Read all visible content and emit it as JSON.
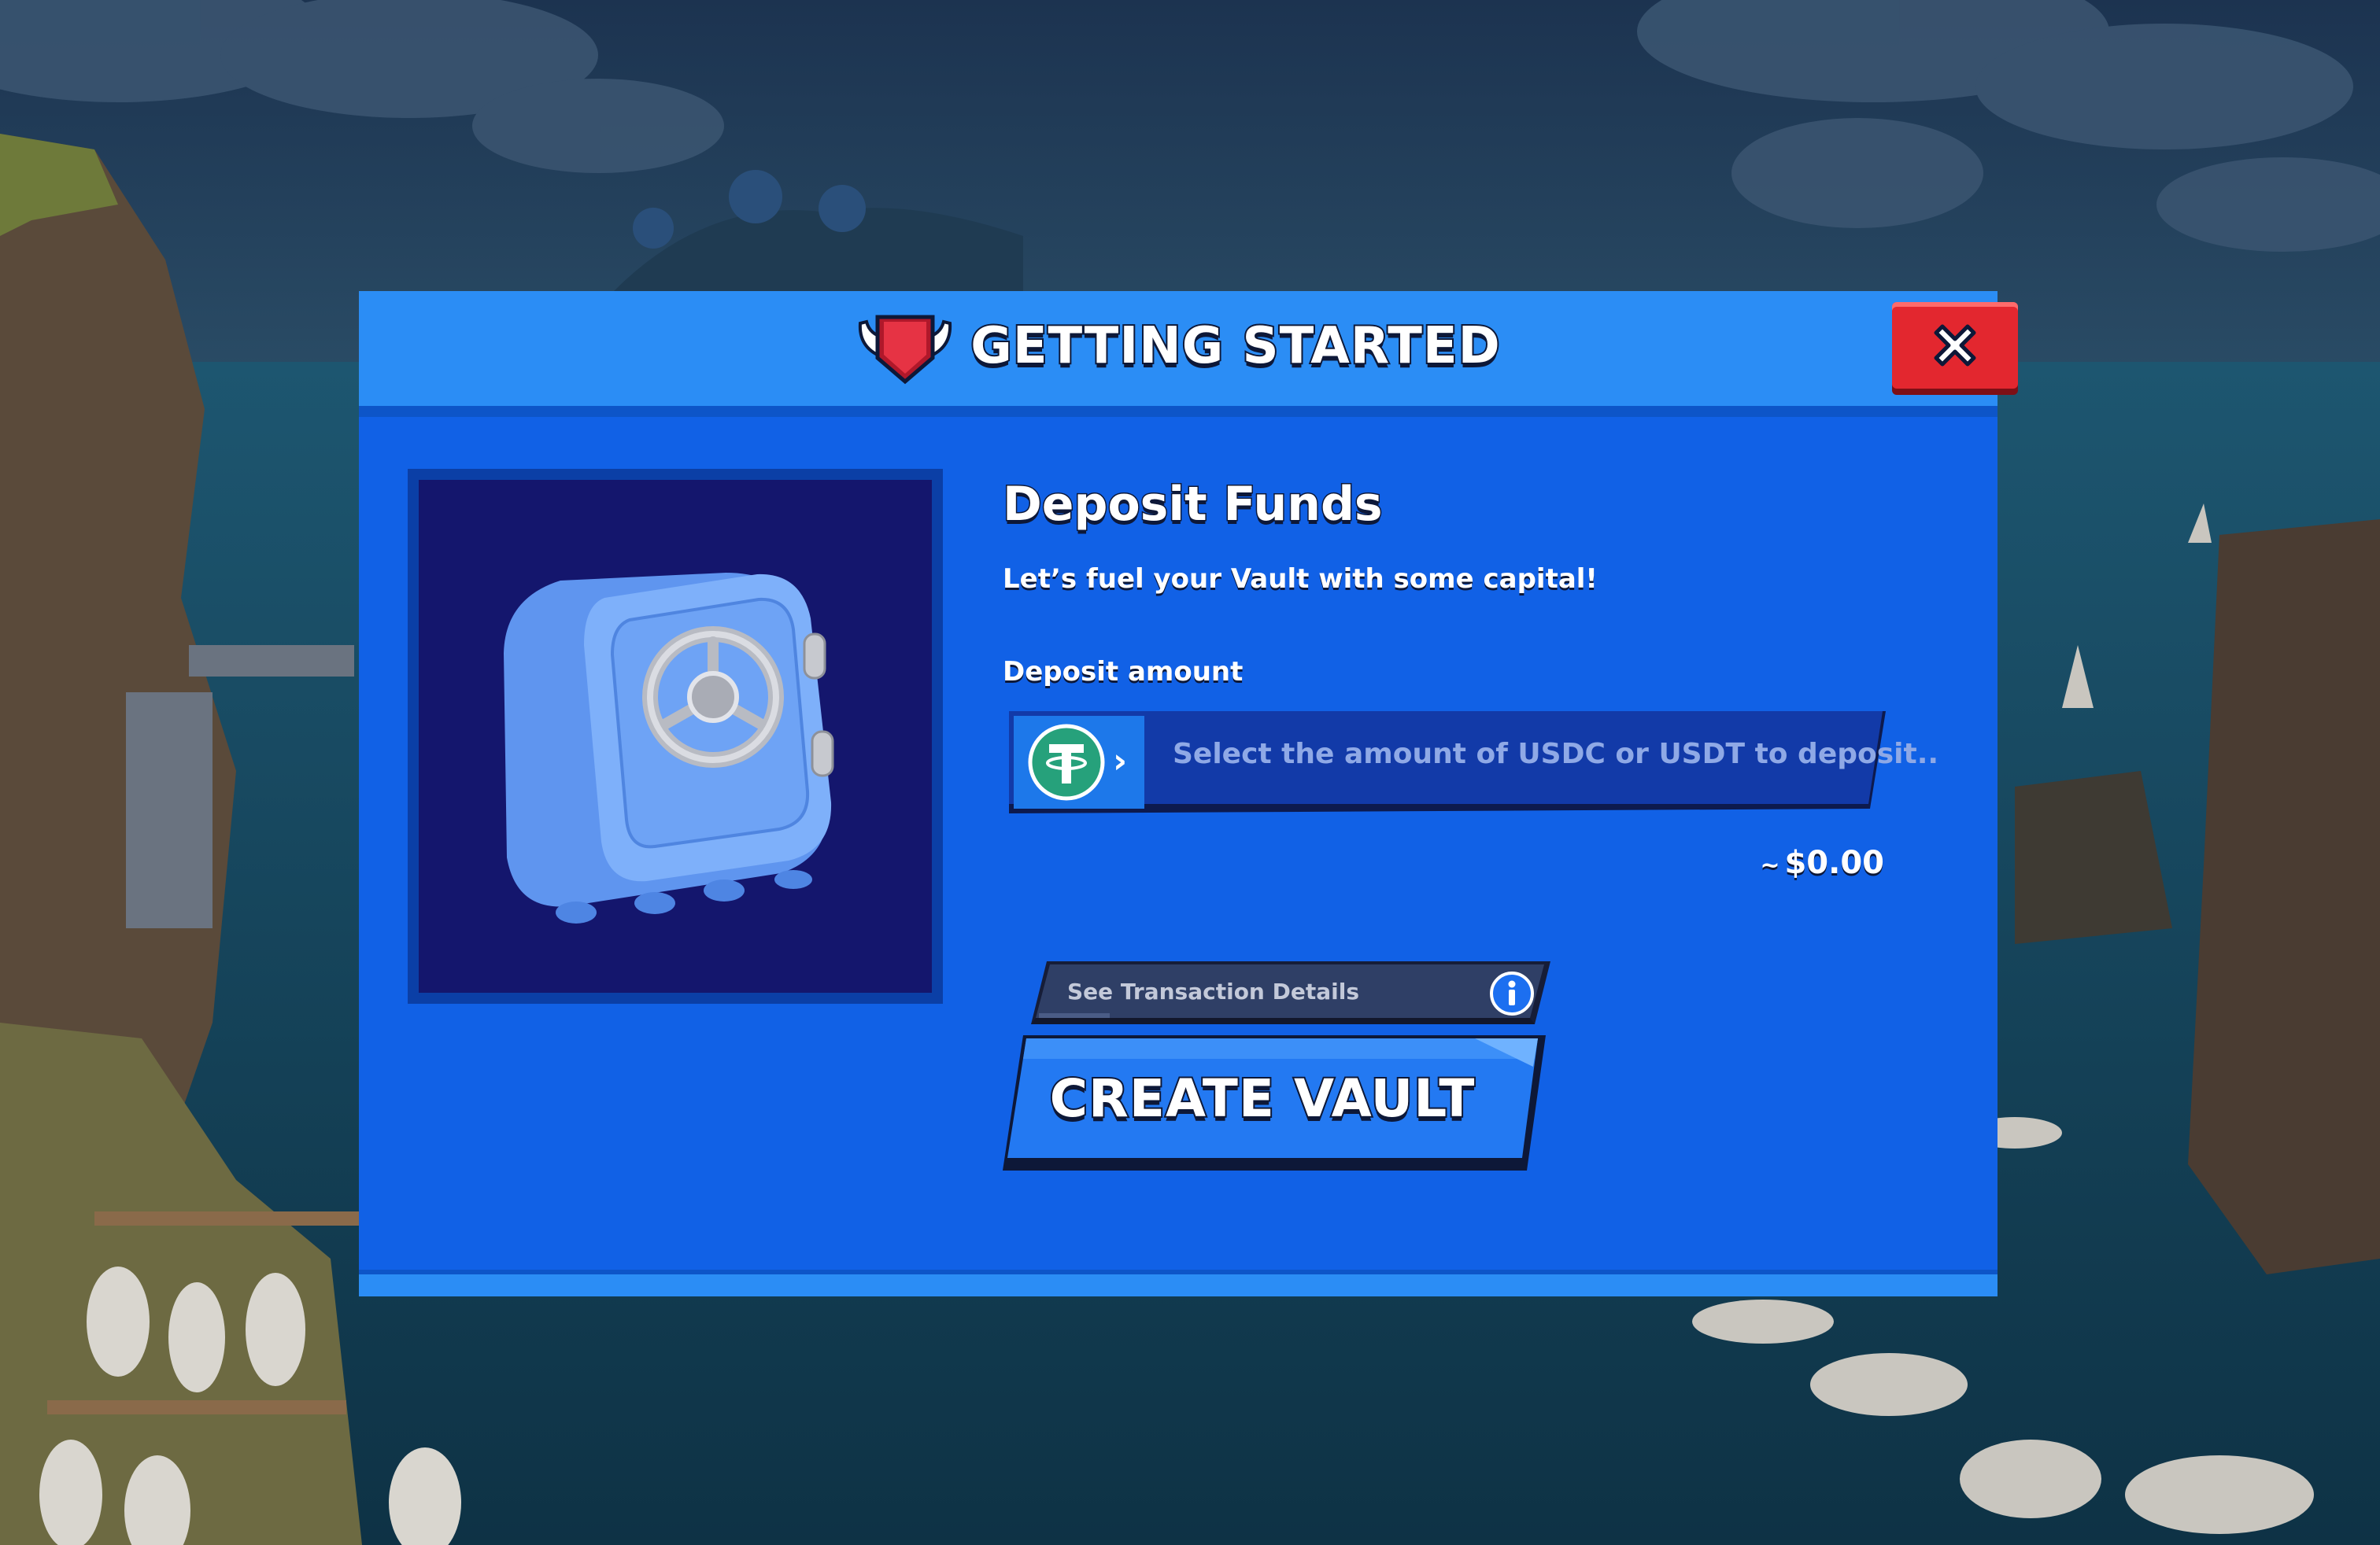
{
  "modal": {
    "title": "GETTING STARTED",
    "close_icon": "close-x-icon",
    "header_icon": "winged-shield-icon"
  },
  "deposit": {
    "title": "Deposit Funds",
    "subtitle": "Let’s fuel your Vault with some capital!",
    "amount_label": "Deposit amount",
    "placeholder": "Select the amount of USDC or USDT to deposit..",
    "token_icon": "tether-usdt-icon",
    "usd_tilde": "~",
    "usd_value": "$0.00"
  },
  "transaction_details": {
    "label": "See Transaction Details",
    "icon": "info-icon"
  },
  "actions": {
    "create_vault_label": "CREATE VAULT"
  },
  "illustration": {
    "icon": "vault-safe-icon"
  },
  "colors": {
    "modal_body": "#1161e6",
    "modal_header": "#2b8df5",
    "image_panel": "#14166d",
    "close_button": "#e3272f",
    "tether_green": "#26a17b",
    "create_button": "#2379f2"
  }
}
